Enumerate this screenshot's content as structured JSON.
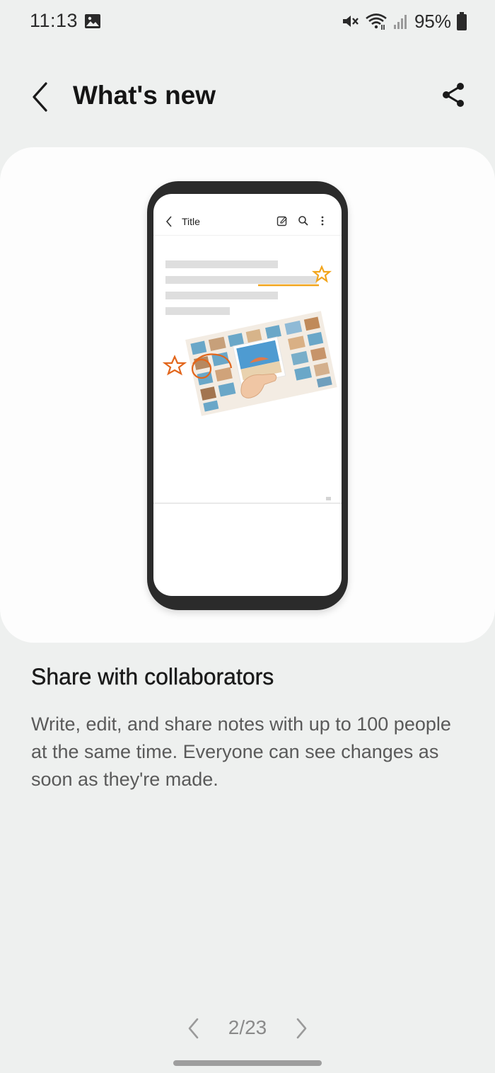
{
  "status_bar": {
    "time": "11:13",
    "battery": "95%",
    "icons": [
      "gallery-icon",
      "mute-icon",
      "wifi-icon",
      "signal-icon",
      "battery-icon"
    ]
  },
  "app_bar": {
    "title": "What's new",
    "back_icon": "chevron-left-icon",
    "share_icon": "share-icon"
  },
  "illustration": {
    "mini_app_title": "Title",
    "mini_icons": [
      "chevron-left-icon",
      "edit-icon",
      "search-icon",
      "more-vert-icon"
    ],
    "accent_colors": {
      "orange": "#e2661c",
      "yellow": "#f2a51c",
      "photo_bg": "#f3ece3"
    }
  },
  "feature": {
    "title": "Share with collaborators",
    "description": "Write, edit, and share notes with up to 100 people at the same time. Everyone can see changes as soon as they're made."
  },
  "pager": {
    "label": "2/23"
  }
}
